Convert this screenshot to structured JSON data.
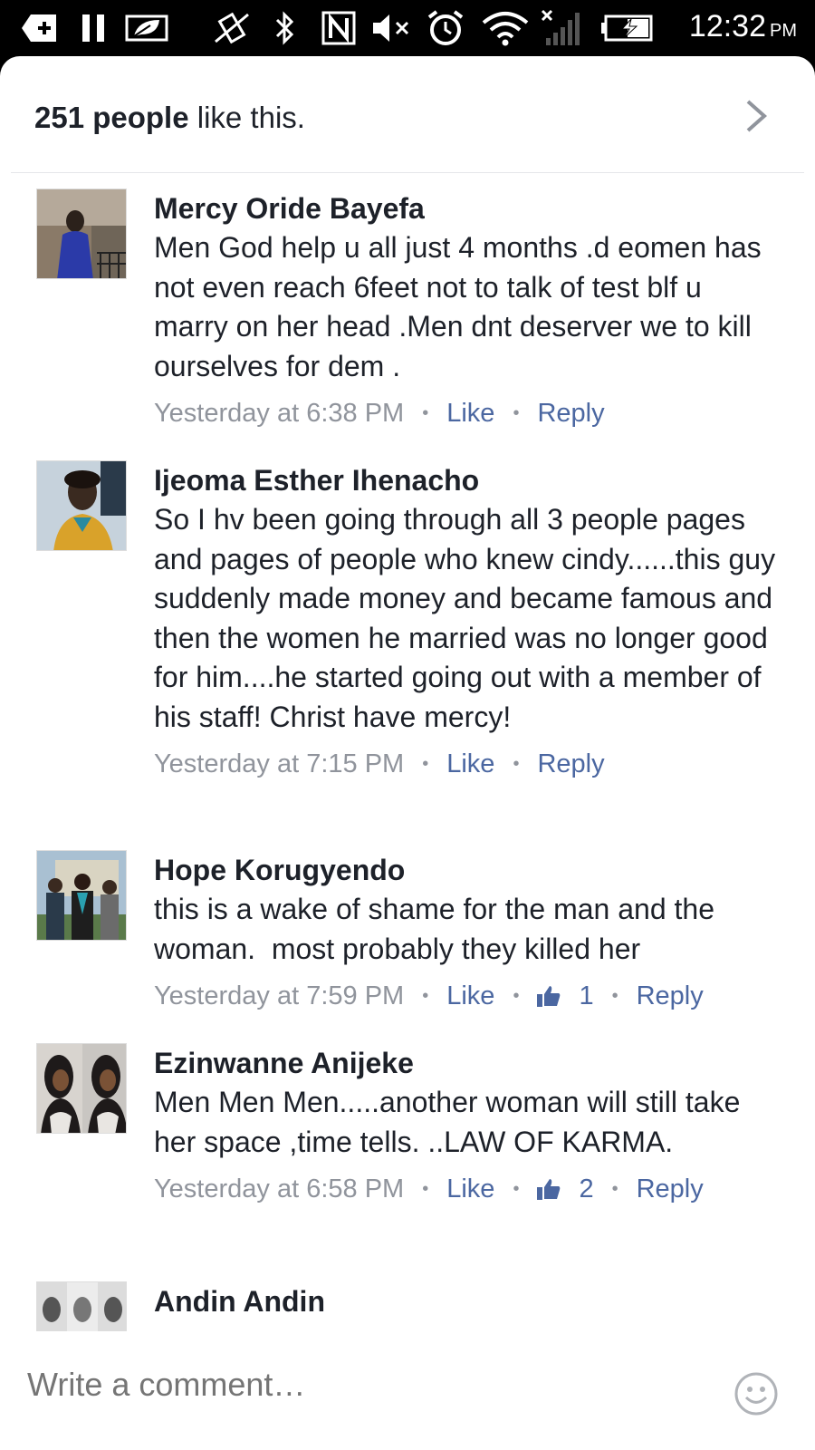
{
  "status_bar": {
    "time": "12:32",
    "ampm": "PM",
    "icons": [
      "add-notification-icon",
      "pause-icon",
      "leaf-icon",
      "vibrate-off-icon",
      "bluetooth-icon",
      "nfc-icon",
      "mute-icon",
      "alarm-icon",
      "wifi-icon",
      "signal-off-icon",
      "battery-charging-icon"
    ]
  },
  "likes_summary": {
    "count_text": "251 people",
    "suffix": " like this."
  },
  "comments": [
    {
      "author": "Mercy Oride Bayefa",
      "body": "Men God help u all just 4 months .d eomen has not even reach 6feet not to talk of test blf u marry on her head .Men dnt deserver we to kill ourselves for dem .",
      "timestamp": "Yesterday at 6:38 PM",
      "like_label": "Like",
      "reply_label": "Reply",
      "avatar_colors": [
        "#6b5c4e",
        "#2b3aa8",
        "#a9a49a"
      ]
    },
    {
      "author": "Ijeoma Esther Ihenacho",
      "body": "So I hv been going through all 3 people pages and pages of people who knew cindy......this guy suddenly made money and became famous and then the women he married was no longer good for him....he started going out with a member of his staff! Christ have mercy!",
      "timestamp": "Yesterday at 7:15 PM",
      "like_label": "Like",
      "reply_label": "Reply",
      "avatar_colors": [
        "#3a2a20",
        "#d9a22a",
        "#b8c9d6"
      ]
    },
    {
      "author": "Hope Korugyendo",
      "body": "this is a wake of shame for the man and the woman.  most probably they killed her",
      "timestamp": "Yesterday at 7:59 PM",
      "like_label": "Like",
      "reaction_count": "1",
      "reply_label": "Reply",
      "avatar_colors": [
        "#9fb6c8",
        "#2a2a2a",
        "#6d8a5a"
      ]
    },
    {
      "author": "Ezinwanne Anijeke",
      "body": "Men Men Men.....another woman will still take her space ,time tells. ..LAW OF KARMA.",
      "timestamp": "Yesterday at 6:58 PM",
      "like_label": "Like",
      "reaction_count": "2",
      "reply_label": "Reply",
      "avatar_colors": [
        "#1e1a1a",
        "#c9c6c2",
        "#555"
      ]
    },
    {
      "author": "Andin Andin",
      "body": "",
      "timestamp": "",
      "avatar_colors": [
        "#cfcfcf",
        "#777",
        "#ececec"
      ]
    }
  ],
  "composer": {
    "placeholder": "Write a comment…",
    "emoji_icon": "smiley-icon"
  },
  "colors": {
    "text": "#1d2129",
    "meta": "#90949c",
    "link": "#4b67a1",
    "divider": "#e5e6ea"
  }
}
